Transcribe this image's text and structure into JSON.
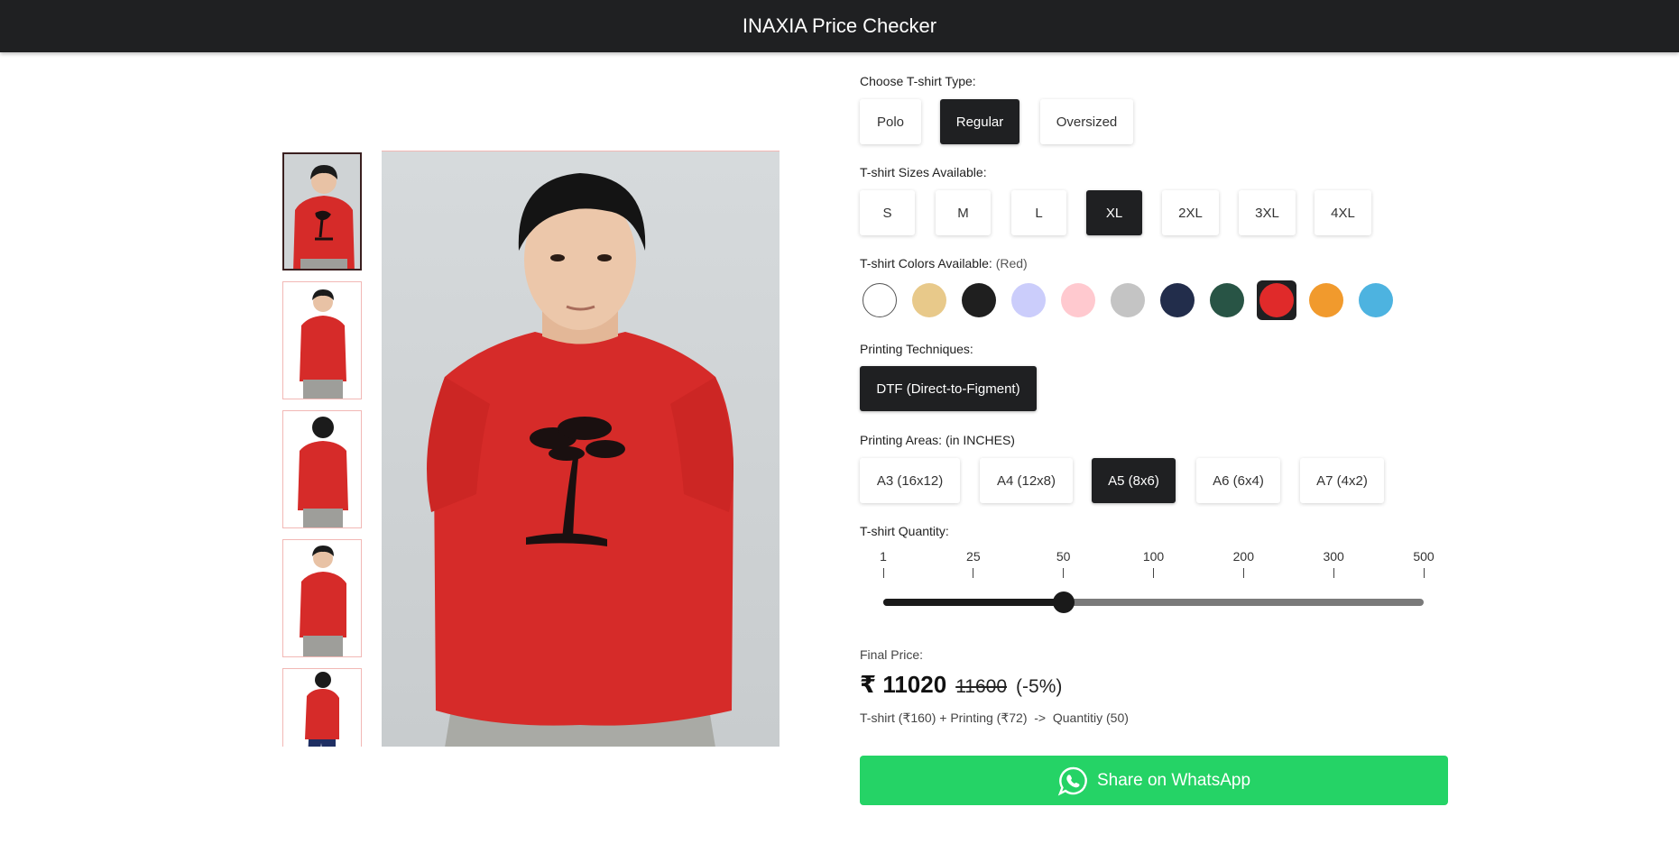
{
  "app": {
    "title": "INAXIA Price Checker"
  },
  "gallery": {
    "thumbnail_count": 5,
    "selected_index": 0,
    "shirt_color": "#d62b29",
    "print_color": "#1a1010"
  },
  "type_section": {
    "label": "Choose T-shirt Type:",
    "options": [
      "Polo",
      "Regular",
      "Oversized"
    ],
    "selected": "Regular"
  },
  "size_section": {
    "label": "T-shirt Sizes Available:",
    "options": [
      "S",
      "M",
      "L",
      "XL",
      "2XL",
      "3XL",
      "4XL"
    ],
    "selected": "XL"
  },
  "color_section": {
    "label": "T-shirt Colors Available:",
    "selected_name": "(Red)",
    "swatches": [
      "#ffffff",
      "#e8c98a",
      "#1f1f1f",
      "#cbcdfb",
      "#ffc9cf",
      "#c4c4c4",
      "#222d4b",
      "#285445",
      "#e02a2a",
      "#f19a2d",
      "#4db3e0"
    ],
    "selected_index": 8
  },
  "technique_section": {
    "label": "Printing Techniques:",
    "options": [
      "DTF (Direct-to-Figment)"
    ],
    "selected": "DTF (Direct-to-Figment)"
  },
  "area_section": {
    "label": "Printing Areas: (in INCHES)",
    "options": [
      "A3 (16x12)",
      "A4 (12x8)",
      "A5 (8x6)",
      "A6 (6x4)",
      "A7 (4x2)"
    ],
    "selected": "A5 (8x6)"
  },
  "quantity_section": {
    "label": "T-shirt Quantity:",
    "ticks": [
      "1",
      "25",
      "50",
      "100",
      "200",
      "300",
      "500"
    ],
    "selected_tick_index": 2
  },
  "price": {
    "label": "Final Price:",
    "current": "₹ 11020",
    "original": "11600",
    "discount": "(-5%)",
    "breakdown": "T-shirt (₹160) + Printing (₹72)  ->  Quantitiy (50)"
  },
  "share": {
    "label": "Share on WhatsApp",
    "color": "#25d366"
  }
}
